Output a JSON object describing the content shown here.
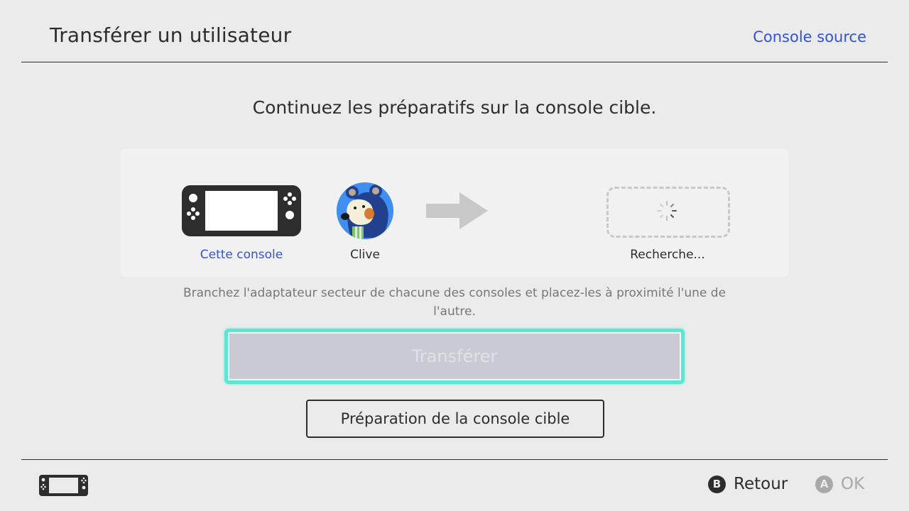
{
  "header": {
    "title": "Transférer un utilisateur",
    "link": "Console source"
  },
  "main": {
    "headline": "Continuez les préparatifs sur la console cible.",
    "source": {
      "icon": "handheld-console-icon",
      "label": "Cette console"
    },
    "user": {
      "icon": "user-avatar",
      "name": "Clive"
    },
    "arrow_icon": "arrow-right-icon",
    "target": {
      "icon": "loading-spinner-icon",
      "label": "Recherche..."
    },
    "hint": "Branchez l'adaptateur secteur de chacune des consoles et placez-les à proximité l'une de l'autre."
  },
  "buttons": {
    "transfer": "Transférer",
    "prepare": "Préparation de la console cible"
  },
  "footer": {
    "console_icon": "handheld-console-icon",
    "back": {
      "key": "B",
      "label": "Retour"
    },
    "ok": {
      "key": "A",
      "label": "OK"
    }
  },
  "colors": {
    "accent_link": "#3452d4",
    "focus_highlight": "#5ae8d3",
    "disabled_button": "#c9cad4"
  }
}
